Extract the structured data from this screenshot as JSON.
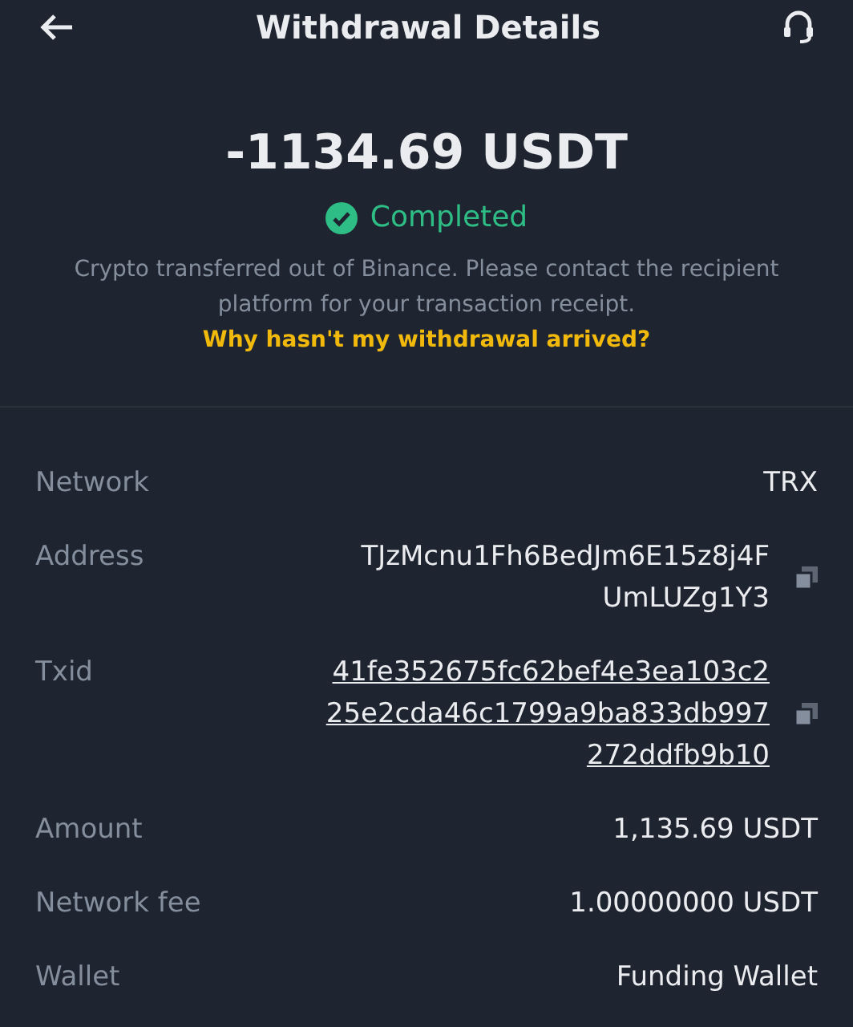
{
  "header": {
    "title": "Withdrawal Details"
  },
  "summary": {
    "amount": "-1134.69 USDT",
    "status": "Completed",
    "message": "Crypto transferred out of Binance. Please contact the recipient platform for your transaction receipt.",
    "help_link": "Why hasn't my withdrawal arrived?"
  },
  "details": [
    {
      "label": "Network",
      "kind": "plain",
      "lines": [
        "TRX"
      ]
    },
    {
      "label": "Address",
      "kind": "copy",
      "lines": [
        "TJzMcnu1Fh6BedJm6E15z8j4F",
        "UmLUZg1Y3"
      ]
    },
    {
      "label": "Txid",
      "kind": "link-copy",
      "lines": [
        "41fe352675fc62bef4e3ea103c2",
        "25e2cda46c1799a9ba833db997",
        "272ddfb9b10"
      ]
    },
    {
      "label": "Amount",
      "kind": "plain",
      "lines": [
        "1,135.69 USDT"
      ]
    },
    {
      "label": "Network fee",
      "kind": "plain",
      "lines": [
        "1.00000000 USDT"
      ]
    },
    {
      "label": "Wallet",
      "kind": "plain",
      "lines": [
        "Funding Wallet"
      ]
    }
  ]
}
